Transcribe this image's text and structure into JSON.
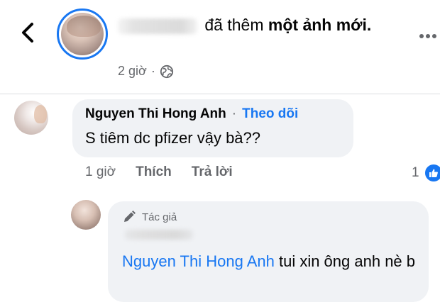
{
  "post": {
    "title_prefix": "đã thêm",
    "title_bold": "một ảnh mới.",
    "time": "2 giờ",
    "separator": "·",
    "more_icon": "more-horizontal-icon",
    "privacy_icon": "globe-icon",
    "back_icon": "chevron-left-icon"
  },
  "comment": {
    "author": "Nguyen Thi Hong Anh",
    "separator": "·",
    "follow": "Theo dõi",
    "text": "S tiêm dc pfizer vậy bà??",
    "time": "1 giờ",
    "like_label": "Thích",
    "reply_label": "Trả lời",
    "reaction_count": "1",
    "reaction_icon": "thumbs-up-icon"
  },
  "reply": {
    "badge": "Tác giả",
    "badge_icon": "pencil-icon",
    "mention": "Nguyen Thi Hong Anh",
    "text": " tui xin ông anh nè b"
  },
  "colors": {
    "accent": "#1877f2",
    "bubble": "#f0f2f5",
    "secondary_text": "#65676b"
  }
}
